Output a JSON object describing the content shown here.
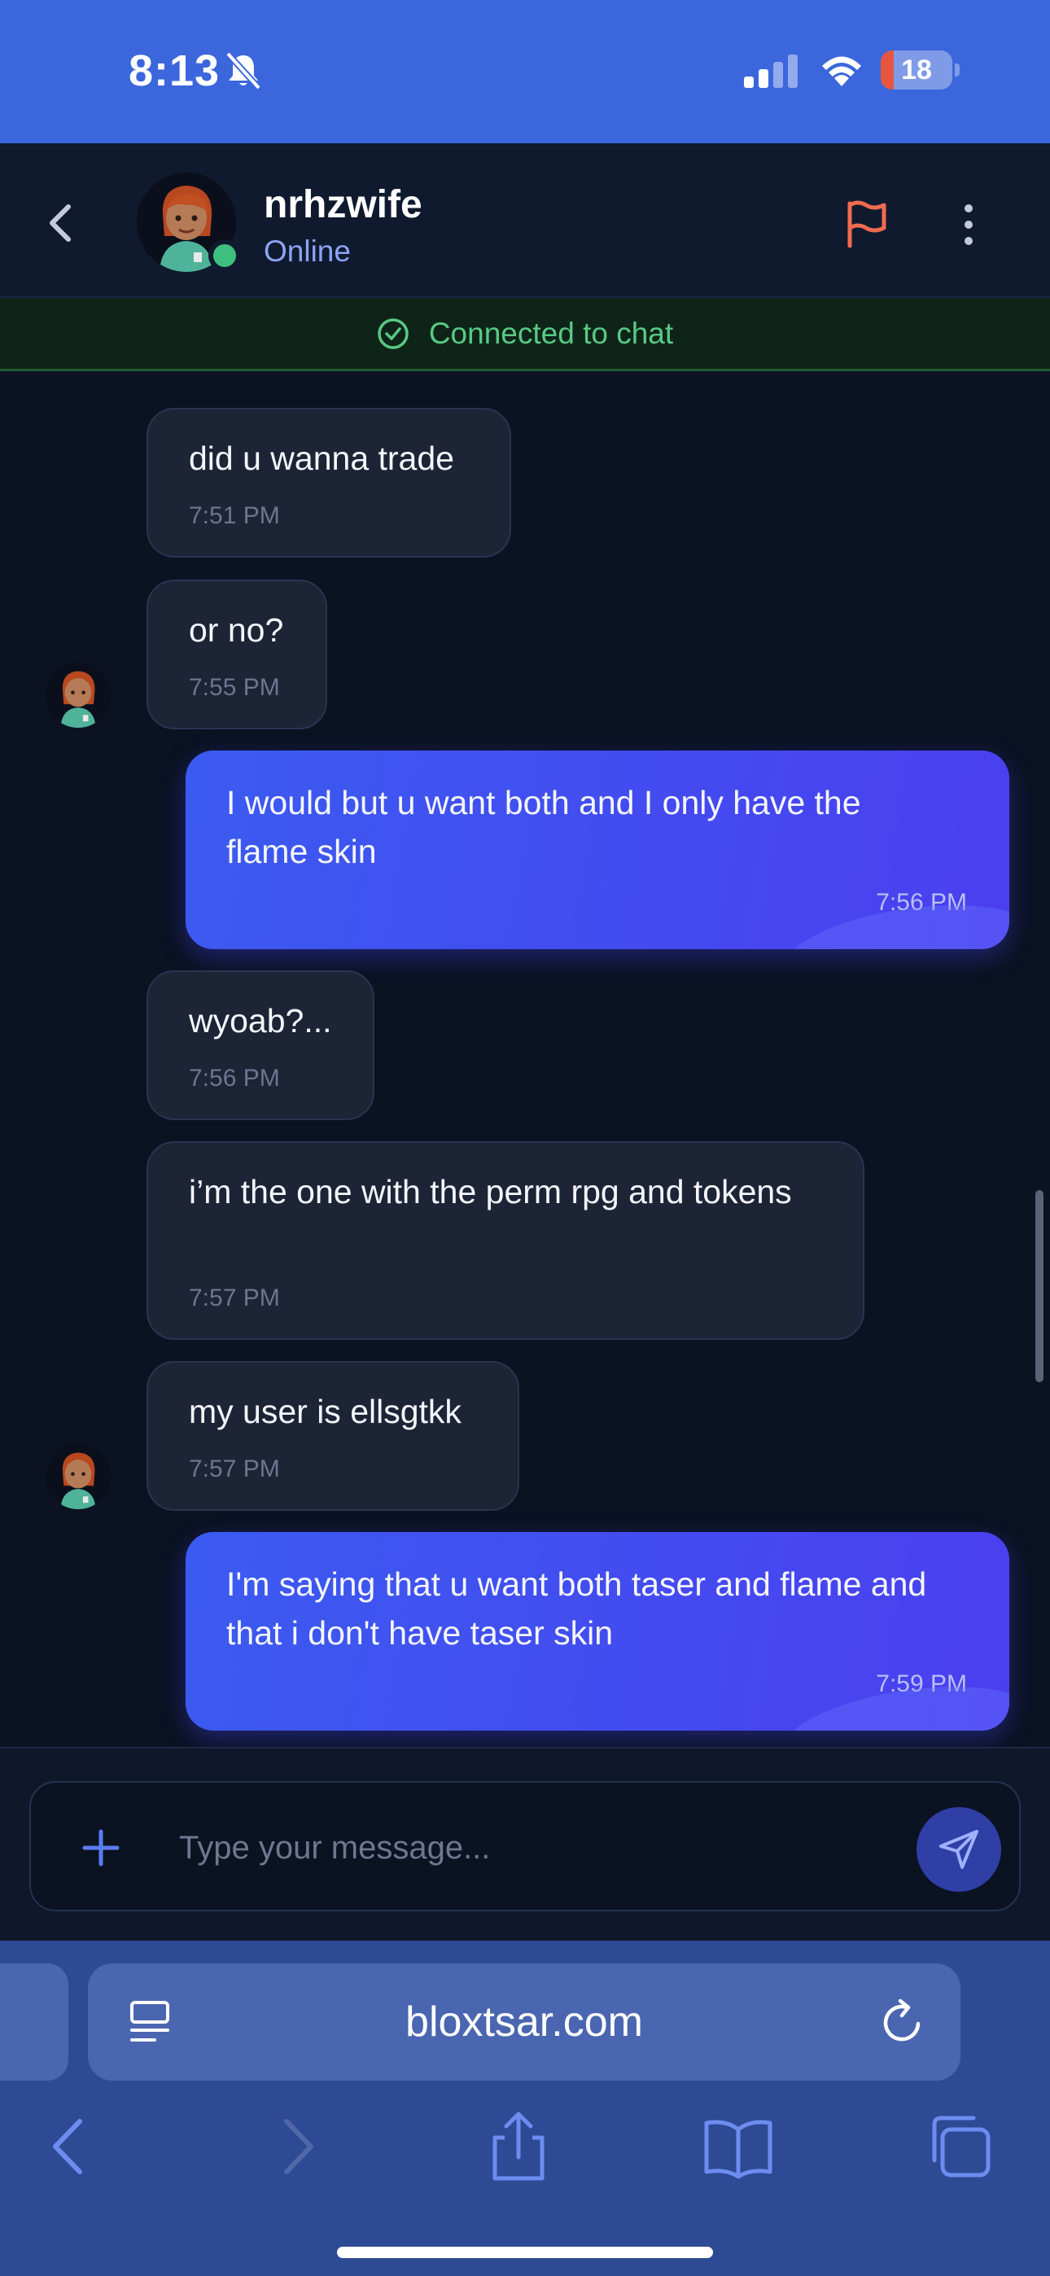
{
  "status_bar": {
    "time": "8:13",
    "battery": "18",
    "battery_level_percent": 18,
    "colors": {
      "background": "#3b66dc",
      "battery_low": "#e8553f"
    }
  },
  "header": {
    "contact_name": "nrhzwife",
    "contact_status": "Online",
    "icons": [
      "chevron-left-icon",
      "avatar",
      "flag-icon",
      "more-vertical-icon"
    ],
    "colors": {
      "status": "#8ea3f5",
      "flag": "#f06b4f",
      "online_dot": "#3fbf7f"
    }
  },
  "banner": {
    "text": "Connected to chat",
    "color": "#58c985"
  },
  "messages": [
    {
      "direction": "in",
      "text": "did u wanna trade",
      "time": "7:51 PM"
    },
    {
      "direction": "in",
      "text": "or no?",
      "time": "7:55 PM"
    },
    {
      "direction": "out",
      "text": "I would but u want both and I only have the flame skin",
      "time": "7:56 PM"
    },
    {
      "direction": "in",
      "text": "wyoab?...",
      "time": "7:56 PM"
    },
    {
      "direction": "in",
      "text": "i’m the one with the perm rpg and tokens",
      "time": "7:57 PM"
    },
    {
      "direction": "in",
      "text": "my user is ellsgtkk",
      "time": "7:57 PM"
    },
    {
      "direction": "out",
      "text": "I'm saying that u want both taser and flame and that i don't have taser skin",
      "time": "7:59 PM"
    }
  ],
  "composer": {
    "placeholder": "Type your message...",
    "value": ""
  },
  "browser": {
    "url": "bloxtsar.com"
  }
}
